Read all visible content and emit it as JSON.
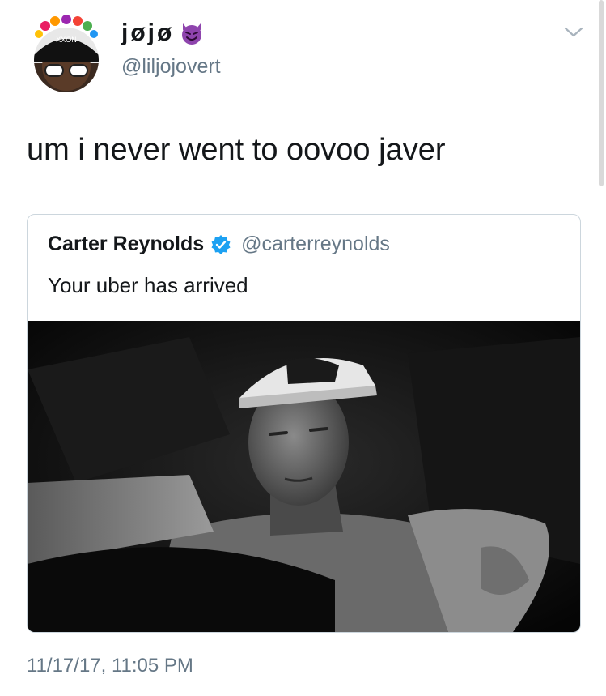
{
  "author": {
    "display_name": "jøjø",
    "handle": "@liljojovert",
    "name_emoji": "smiling-imp-emoji",
    "avatar_hat_text": "XXON"
  },
  "tweet": {
    "text": "um i never went to oovoo javer",
    "timestamp": "11/17/17, 11:05 PM"
  },
  "quoted_tweet": {
    "display_name": "Carter Reynolds",
    "verified": true,
    "handle": "@carterreynolds",
    "text": "Your uber has arrived",
    "media": "black-and-white-photo-man-in-car"
  },
  "colors": {
    "text_primary": "#14171a",
    "text_secondary": "#657786",
    "border": "#ccd6dd",
    "verified_blue": "#1da1f2",
    "emoji_purple": "#8e44ad"
  },
  "icons": [
    "chevron-down-icon",
    "verified-badge-icon",
    "smiling-imp-emoji"
  ]
}
